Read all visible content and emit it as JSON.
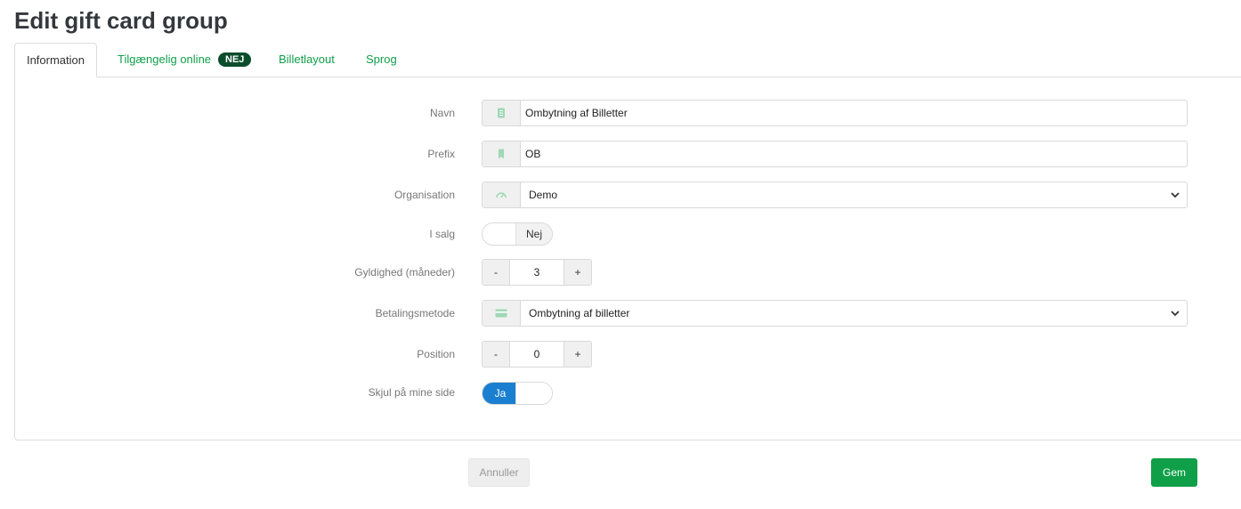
{
  "page": {
    "title": "Edit gift card group"
  },
  "tabs": [
    {
      "label": "Information",
      "active": true
    },
    {
      "label": "Tilgængelig online",
      "badge": "NEJ"
    },
    {
      "label": "Billetlayout"
    },
    {
      "label": "Sprog"
    }
  ],
  "form": {
    "navn": {
      "label": "Navn",
      "value": "Ombytning af Billetter",
      "icon": "document-icon"
    },
    "prefix": {
      "label": "Prefix",
      "value": "OB",
      "icon": "bookmark-icon"
    },
    "organisation": {
      "label": "Organisation",
      "value": "Demo",
      "icon": "gauge-icon"
    },
    "i_salg": {
      "label": "I salg",
      "state_label": "Nej",
      "on": false
    },
    "gyldighed": {
      "label": "Gyldighed (måneder)",
      "minus": "-",
      "value": "3",
      "plus": "+"
    },
    "betalingsmetode": {
      "label": "Betalingsmetode",
      "value": "Ombytning af billetter",
      "icon": "credit-card-icon"
    },
    "position": {
      "label": "Position",
      "minus": "-",
      "value": "0",
      "plus": "+"
    },
    "skjul": {
      "label": "Skjul på mine side",
      "state_label": "Ja",
      "on": true
    }
  },
  "footer": {
    "cancel_label": "Annuller",
    "save_label": "Gem"
  },
  "colors": {
    "accent_green": "#0f9f48",
    "badge_dark_green": "#0c4d2b",
    "toggle_blue": "#1a7fd0"
  }
}
